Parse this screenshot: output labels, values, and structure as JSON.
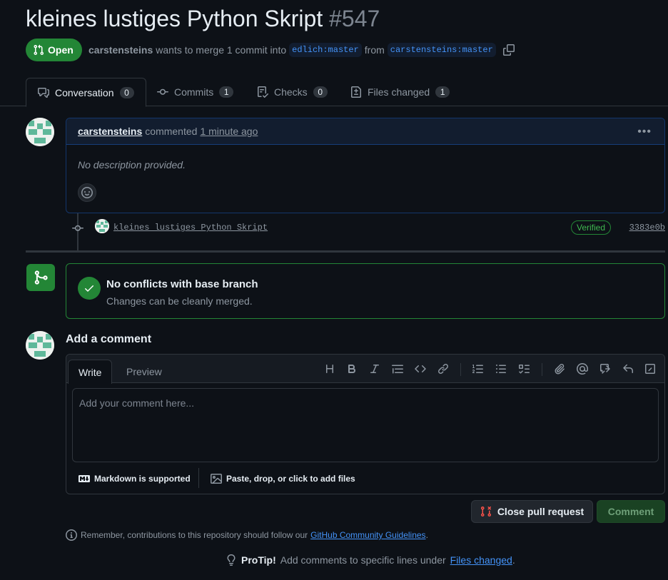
{
  "pr": {
    "title": "kleines lustiges Python Skript",
    "number": "#547",
    "state": "Open",
    "author": "carstensteins",
    "merge_text": "wants to merge 1 commit into",
    "base_branch": "edlich:master",
    "from_text": "from",
    "head_branch": "carstensteins:master"
  },
  "tabs": [
    {
      "label": "Conversation",
      "count": "0",
      "icon": "conversation-icon"
    },
    {
      "label": "Commits",
      "count": "1",
      "icon": "commit-icon"
    },
    {
      "label": "Checks",
      "count": "0",
      "icon": "checklist-icon"
    },
    {
      "label": "Files changed",
      "count": "1",
      "icon": "file-diff-icon"
    }
  ],
  "comment": {
    "author": "carstensteins",
    "action": "commented",
    "time": "1 minute ago",
    "body": "No description provided."
  },
  "commit": {
    "message": "kleines lustiges Python Skript",
    "badge": "Verified",
    "sha": "3383e0b"
  },
  "merge": {
    "title": "No conflicts with base branch",
    "subtitle": "Changes can be cleanly merged."
  },
  "editor": {
    "heading": "Add a comment",
    "write_tab": "Write",
    "preview_tab": "Preview",
    "placeholder": "Add your comment here...",
    "markdown_note": "Markdown is supported",
    "attach_note": "Paste, drop, or click to add files"
  },
  "actions": {
    "close_label": "Close pull request",
    "comment_label": "Comment"
  },
  "footer": {
    "remember_text": "Remember, contributions to this repository should follow our",
    "guidelines_link": "GitHub Community Guidelines",
    "period": ".",
    "protip_label": "ProTip!",
    "protip_text": "Add comments to specific lines under",
    "files_changed_link": "Files changed"
  },
  "colors": {
    "background": "#0d1117",
    "accent_green": "#238636",
    "link_blue": "#4493f8",
    "danger_red": "#f85149"
  }
}
